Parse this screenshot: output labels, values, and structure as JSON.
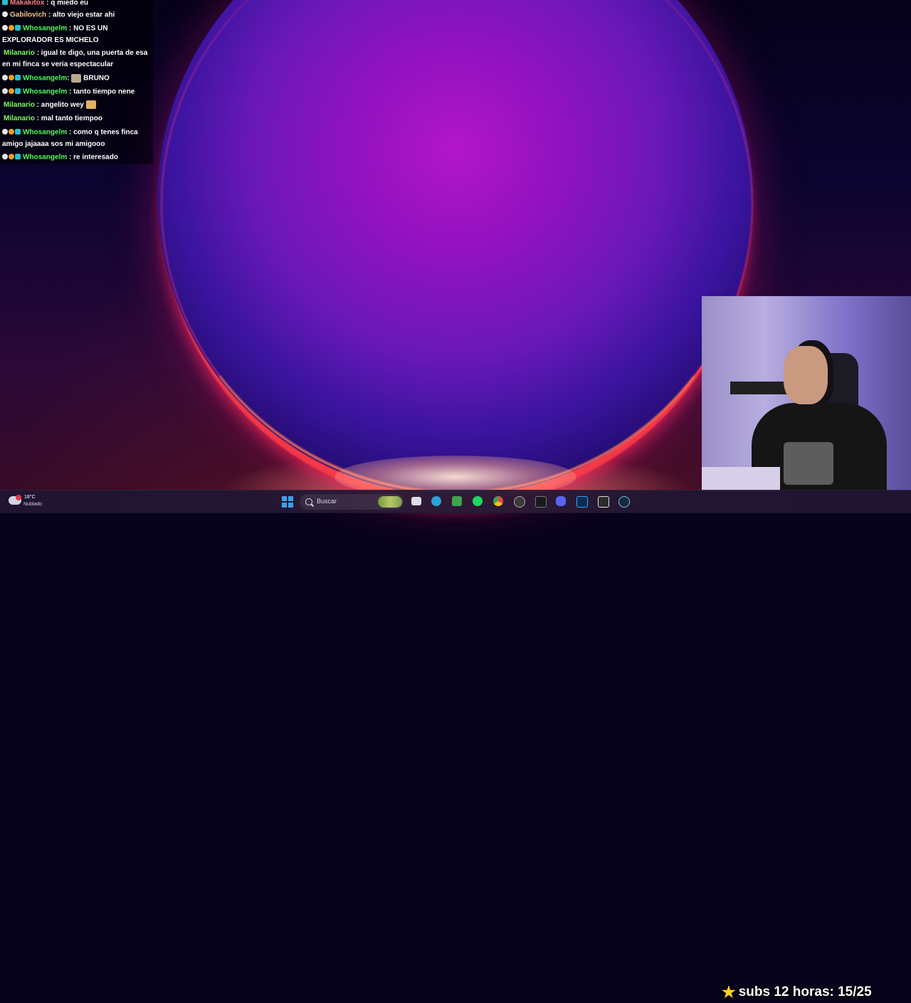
{
  "chat": {
    "messages": [
      {
        "user": "Makakitox",
        "text": ": q miedo eu",
        "color": "#ff7f7f",
        "badges": [
          "cyan"
        ]
      },
      {
        "user": "Gabilovich",
        "text": ": alto viejo estar ahi",
        "color": "#f5c58a",
        "badges": [
          "white"
        ]
      },
      {
        "user": "Whosangelm",
        "text": ": NO ES UN",
        "continuation": "EXPLORADOR ES MICHELO",
        "color": "#4cff5a",
        "badges": [
          "white",
          "orange",
          "cyan"
        ]
      },
      {
        "user": "Milanario",
        "text": ": igual te digo, una puerta de esa",
        "continuation": "en mi finca se veria espectacular",
        "color": "#7fff5a",
        "badges": []
      },
      {
        "user": "Whosangelm",
        "text": ": ",
        "after_emote": "BRUNO",
        "color": "#4cff5a",
        "badges": [
          "white",
          "orange",
          "cyan"
        ],
        "emote": "cat-emote"
      },
      {
        "user": "Whosangelm",
        "text": ": tanto tiempo nene",
        "color": "#4cff5a",
        "badges": [
          "white",
          "orange",
          "cyan"
        ]
      },
      {
        "user": "Milanario",
        "text": ": angelito wey",
        "color": "#7fff5a",
        "badges": [],
        "emote": "angel-emote"
      },
      {
        "user": "Milanario",
        "text": ": mal tanto tiempoo",
        "color": "#7fff5a",
        "badges": []
      },
      {
        "user": "Whosangelm",
        "text": ": como q tenes finca",
        "continuation": "amigo jajaaaa sos mi amigooo",
        "color": "#4cff5a",
        "badges": [
          "white",
          "orange",
          "cyan"
        ]
      },
      {
        "user": "Whosangelm",
        "text": ": re interesado",
        "color": "#4cff5a",
        "badges": [
          "white",
          "orange",
          "cyan"
        ]
      }
    ]
  },
  "weather": {
    "temp": "18°C",
    "desc": "Nublado"
  },
  "search": {
    "label": "Buscar"
  },
  "taskbar": {
    "apps": [
      "task-view-icon",
      "edge-icon",
      "minecraft-icon",
      "spotify-icon",
      "chrome-icon",
      "obs-icon",
      "capcut-icon",
      "discord-icon",
      "photoshop-icon",
      "capcut-alt-icon",
      "steam-icon"
    ],
    "colors": {
      "edge": "#2aa3d8",
      "minecraft": "#3fa34d",
      "spotify": "#1ed760",
      "chrome": "#e8453c",
      "obs": "#2a2a2a",
      "capcut": "#1a1a1a",
      "discord": "#5865f2",
      "photoshop": "#0c2a55",
      "steam": "#1b2838"
    }
  },
  "overlay": {
    "text": "subs 12 horas: 15/25"
  }
}
